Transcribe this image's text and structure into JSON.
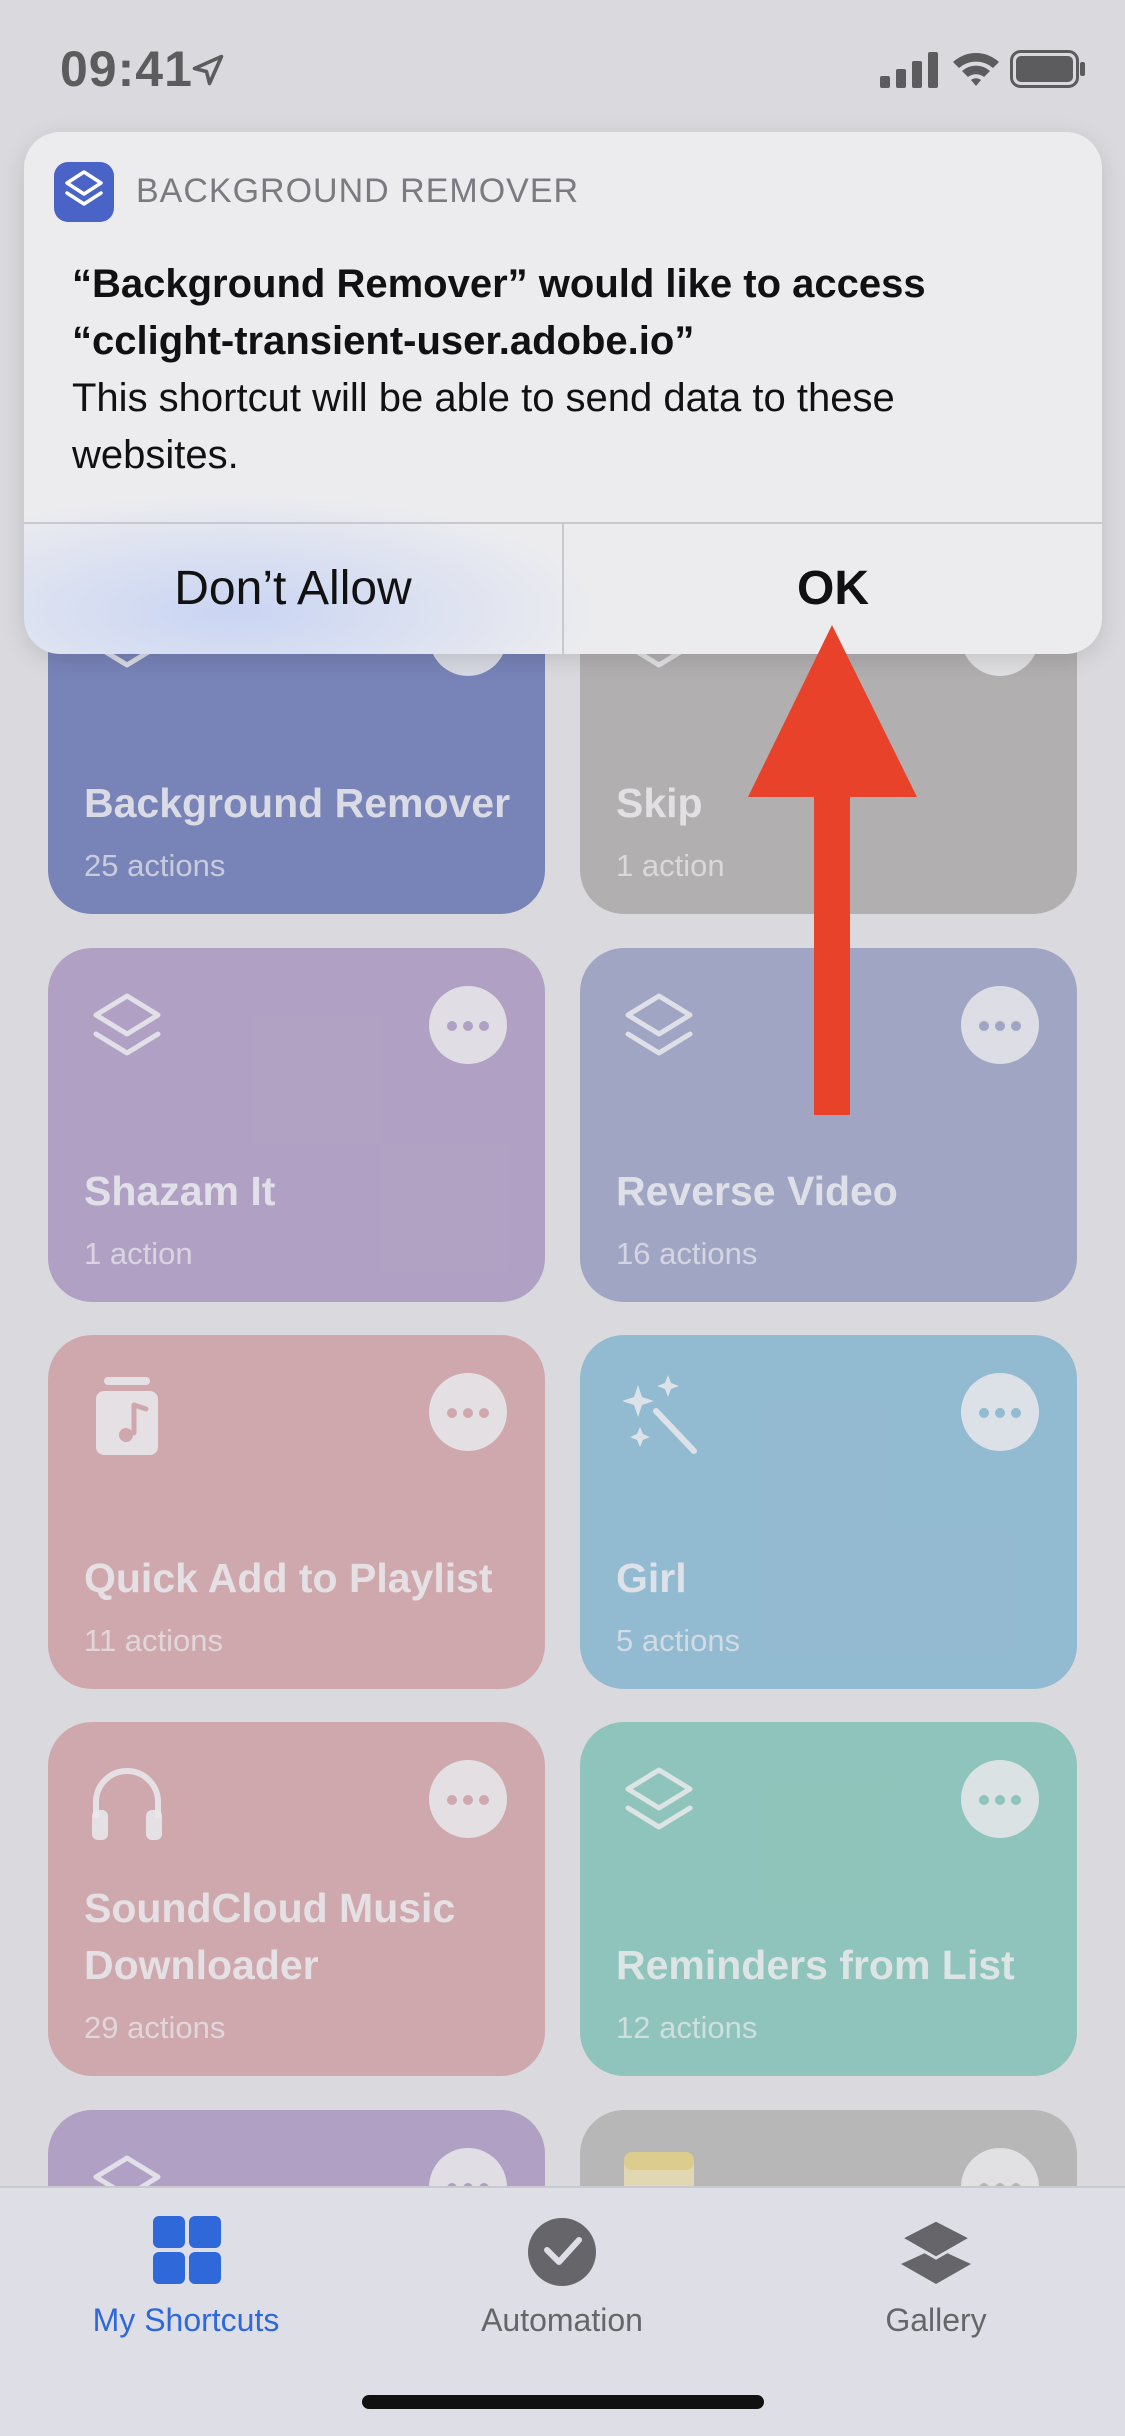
{
  "status_bar": {
    "time": "09:41"
  },
  "alert": {
    "app_name": "BACKGROUND REMOVER",
    "title_line1": "“Background Remover” would like to access",
    "title_line2": "“cclight-transient-user.adobe.io”",
    "body": "This shortcut will be able to send data to these websites.",
    "deny_label": "Don’t Allow",
    "ok_label": "OK"
  },
  "shortcuts": [
    {
      "title": "Background Remover",
      "subtitle": "25 actions",
      "icon": "layers-icon",
      "color": "#3347a3"
    },
    {
      "title": "Skip",
      "subtitle": "1 action",
      "icon": "layers-icon",
      "color": "#9d9894"
    },
    {
      "title": "Shazam It",
      "subtitle": "1 action",
      "icon": "layers-icon",
      "color": "#9a7fb8"
    },
    {
      "title": "Reverse Video",
      "subtitle": "16 actions",
      "icon": "layers-icon",
      "color": "#7c86b8"
    },
    {
      "title": "Quick Add to Playlist",
      "subtitle": "11 actions",
      "icon": "music-note-icon",
      "color": "#d18a91"
    },
    {
      "title": "Girl",
      "subtitle": "5 actions",
      "icon": "magic-wand-icon",
      "color": "#63abd0"
    },
    {
      "title": "SoundCloud Music Downloader",
      "subtitle": "29 actions",
      "icon": "headphones-icon",
      "color": "#d18a91"
    },
    {
      "title": "Reminders from List",
      "subtitle": "12 actions",
      "icon": "layers-icon",
      "color": "#5cbda8"
    },
    {
      "title": "",
      "subtitle": "",
      "icon": "layers-icon",
      "color": "#9a7fb8"
    },
    {
      "title": "",
      "subtitle": "",
      "icon": "notes-icon",
      "color": "#a8a7a3"
    }
  ],
  "tabs": [
    {
      "label": "My Shortcuts",
      "icon": "grid-icon",
      "active": true,
      "color": "#2f68d8"
    },
    {
      "label": "Automation",
      "icon": "clock-icon",
      "active": false,
      "color": "#66666a"
    },
    {
      "label": "Gallery",
      "icon": "stack-icon",
      "active": false,
      "color": "#66666a"
    }
  ],
  "annotation": {
    "color": "#e8432a"
  }
}
